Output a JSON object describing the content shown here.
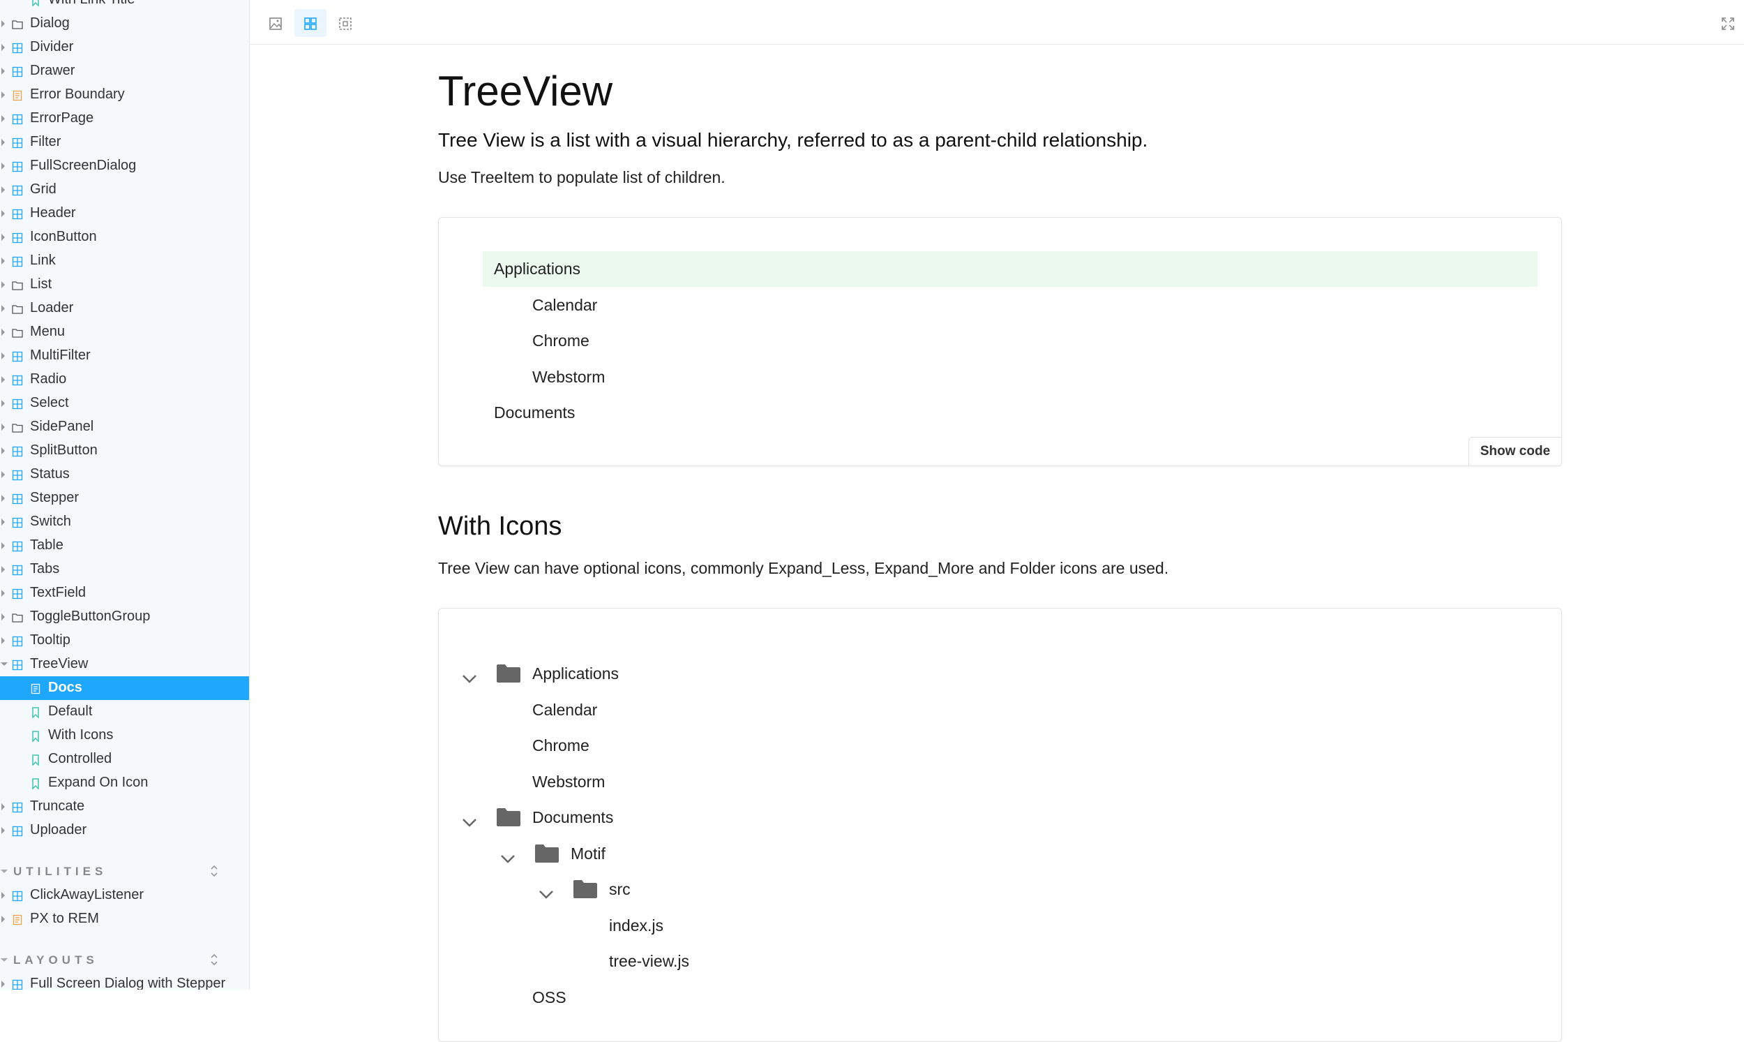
{
  "sidebar": {
    "top_partial": "With Link Title",
    "items": [
      {
        "label": "Dialog",
        "icon": "folder"
      },
      {
        "label": "Divider",
        "icon": "component"
      },
      {
        "label": "Drawer",
        "icon": "component"
      },
      {
        "label": "Error Boundary",
        "icon": "document"
      },
      {
        "label": "ErrorPage",
        "icon": "component"
      },
      {
        "label": "Filter",
        "icon": "component"
      },
      {
        "label": "FullScreenDialog",
        "icon": "component"
      },
      {
        "label": "Grid",
        "icon": "component"
      },
      {
        "label": "Header",
        "icon": "component"
      },
      {
        "label": "IconButton",
        "icon": "component"
      },
      {
        "label": "Link",
        "icon": "component"
      },
      {
        "label": "List",
        "icon": "folder"
      },
      {
        "label": "Loader",
        "icon": "folder"
      },
      {
        "label": "Menu",
        "icon": "folder"
      },
      {
        "label": "MultiFilter",
        "icon": "component"
      },
      {
        "label": "Radio",
        "icon": "component"
      },
      {
        "label": "Select",
        "icon": "component"
      },
      {
        "label": "SidePanel",
        "icon": "folder"
      },
      {
        "label": "SplitButton",
        "icon": "component"
      },
      {
        "label": "Status",
        "icon": "component"
      },
      {
        "label": "Stepper",
        "icon": "component"
      },
      {
        "label": "Switch",
        "icon": "component"
      },
      {
        "label": "Table",
        "icon": "component"
      },
      {
        "label": "Tabs",
        "icon": "component"
      },
      {
        "label": "TextField",
        "icon": "component"
      },
      {
        "label": "ToggleButtonGroup",
        "icon": "folder"
      },
      {
        "label": "Tooltip",
        "icon": "component"
      },
      {
        "label": "TreeView",
        "icon": "component"
      }
    ],
    "treeview_children": [
      {
        "label": "Docs",
        "icon": "document"
      },
      {
        "label": "Default",
        "icon": "bookmark"
      },
      {
        "label": "With Icons",
        "icon": "bookmark"
      },
      {
        "label": "Controlled",
        "icon": "bookmark"
      },
      {
        "label": "Expand On Icon",
        "icon": "bookmark"
      }
    ],
    "after_items": [
      {
        "label": "Truncate",
        "icon": "component"
      },
      {
        "label": "Uploader",
        "icon": "component"
      }
    ],
    "utilities_header": "UTILITIES",
    "utilities": [
      {
        "label": "ClickAwayListener",
        "icon": "component"
      },
      {
        "label": "PX to REM",
        "icon": "document"
      }
    ],
    "layouts_header": "LAYOUTS",
    "layouts": [
      {
        "label": "Full Screen Dialog with Stepper",
        "icon": "component"
      }
    ],
    "active_item": "Docs",
    "accent_color": "#1ea7fd"
  },
  "toolbar": {
    "buttons": [
      "image-icon",
      "grid-icon",
      "outline-icon"
    ],
    "active": "grid-icon",
    "fullscreen": "fullscreen-icon"
  },
  "main": {
    "title": "TreeView",
    "subtitle": "Tree View is a list with a visual hierarchy, referred to as a parent-child relationship.",
    "intro": "Use TreeItem to populate list of children.",
    "preview1": {
      "nodes": [
        {
          "label": "Applications",
          "depth": 0,
          "selected": true
        },
        {
          "label": "Calendar",
          "depth": 1
        },
        {
          "label": "Chrome",
          "depth": 1
        },
        {
          "label": "Webstorm",
          "depth": 1
        },
        {
          "label": "Documents",
          "depth": 0
        }
      ],
      "show_code": "Show code"
    },
    "section2": {
      "title": "With Icons",
      "description": "Tree View can have optional icons, commonly Expand_Less, Expand_More and Folder icons are used."
    },
    "preview2": {
      "nodes": [
        {
          "label": "Applications",
          "depth": 0,
          "expandable": true
        },
        {
          "label": "Calendar",
          "depth": 1
        },
        {
          "label": "Chrome",
          "depth": 1
        },
        {
          "label": "Webstorm",
          "depth": 1
        },
        {
          "label": "Documents",
          "depth": 0,
          "expandable": true
        },
        {
          "label": "Motif",
          "depth": 1,
          "expandable": true
        },
        {
          "label": "src",
          "depth": 2,
          "expandable": true
        },
        {
          "label": "index.js",
          "depth": 3
        },
        {
          "label": "tree-view.js",
          "depth": 3
        },
        {
          "label": "OSS",
          "depth": 1
        }
      ]
    }
  }
}
